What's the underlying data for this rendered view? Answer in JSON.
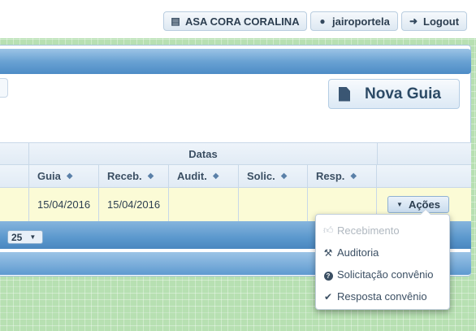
{
  "topbar": {
    "organization": "ASA CORA CORALINA",
    "username": "jairoportela",
    "logout": "Logout"
  },
  "toolbar": {
    "new_guide": "Nova Guia"
  },
  "table": {
    "group_header": "Datas",
    "columns": [
      {
        "label": "Guia"
      },
      {
        "label": "Receb."
      },
      {
        "label": "Audit."
      },
      {
        "label": "Solic."
      },
      {
        "label": "Resp."
      }
    ],
    "rows": [
      {
        "guia": "15/04/2016",
        "receb": "15/04/2016",
        "audit": "",
        "solic": "",
        "resp": ""
      }
    ],
    "actions_label": "Ações"
  },
  "pager": {
    "page_size": "25"
  },
  "actions_menu": {
    "items": [
      {
        "label": "Recebimento",
        "icon": "thumbs-up-icon",
        "disabled": true
      },
      {
        "label": "Auditoria",
        "icon": "gavel-icon",
        "disabled": false
      },
      {
        "label": "Solicitação convênio",
        "icon": "question-circle-icon",
        "disabled": false
      },
      {
        "label": "Resposta convênio",
        "icon": "check-icon",
        "disabled": false
      }
    ]
  },
  "colors": {
    "background": "#b7e0b2",
    "header_blue": "#5b98cd",
    "row_highlight": "#fbfbd6"
  }
}
